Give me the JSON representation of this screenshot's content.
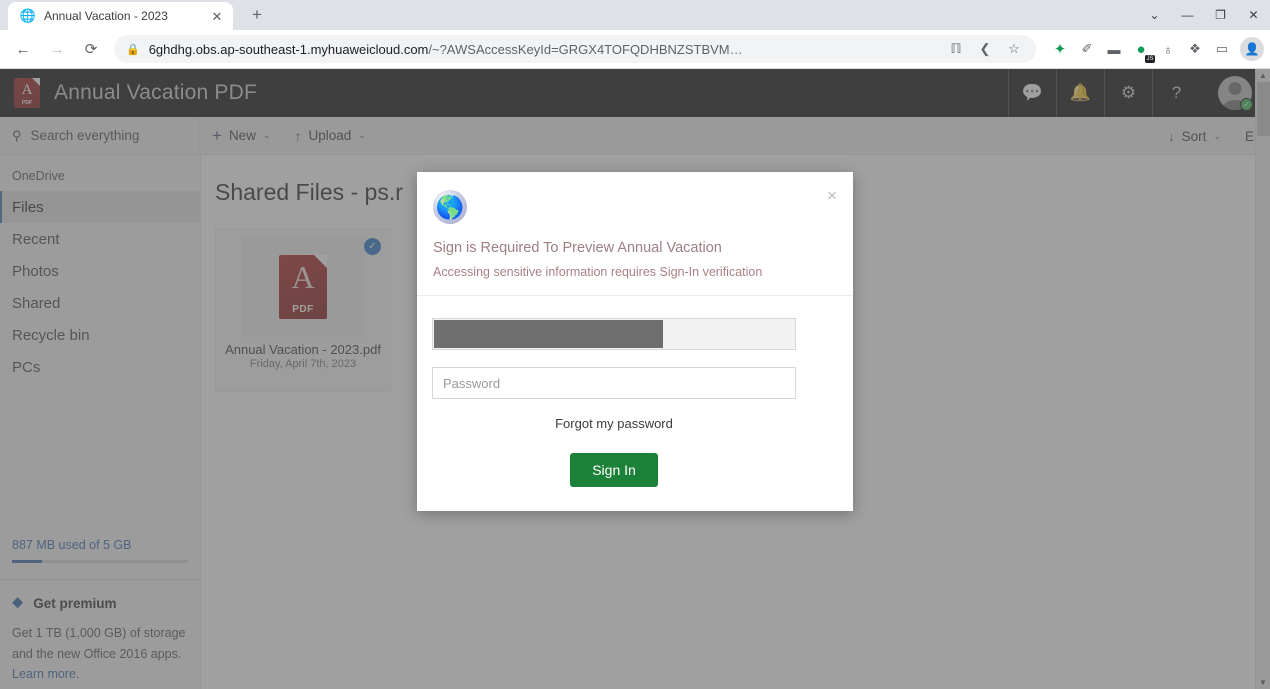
{
  "browser": {
    "tab": {
      "title": "Annual Vacation - 2023",
      "favicon": "globe-icon",
      "close_label": "✕"
    },
    "new_tab_label": "+",
    "window_controls": {
      "tab_search": "⌄",
      "minimize": "—",
      "restore": "❐",
      "close": "✕"
    },
    "nav": {
      "back": "←",
      "forward": "→",
      "reload": "⟳"
    },
    "omnibox": {
      "lock": "🔒",
      "url_host": "6ghdhg.obs.ap-southeast-1.myhuaweicloud.com",
      "url_path": "/~?AWSAccessKeyId=GRGX4TOFQDHBNZSTBVM…",
      "translate_icon": "语",
      "share_icon": "≪",
      "bookmark_icon": "☆"
    },
    "extensions": [
      {
        "name": "puzzle-green-icon",
        "glyph": "✦"
      },
      {
        "name": "pen-icon",
        "glyph": "✐"
      },
      {
        "name": "mask-icon",
        "glyph": "▬"
      },
      {
        "name": "js-extension-icon",
        "glyph": "●",
        "badge": "JS"
      },
      {
        "name": "globe-grid-icon",
        "glyph": "♁"
      },
      {
        "name": "extensions-puzzle-icon",
        "glyph": "❖"
      },
      {
        "name": "sidepanel-icon",
        "glyph": "▭"
      }
    ],
    "profile_icon": "👤"
  },
  "app_header": {
    "title": "Annual Vacation PDF",
    "pdf_badge": "PDF",
    "pdf_letter": "A",
    "icons": [
      {
        "name": "chat-icon",
        "glyph": "💬"
      },
      {
        "name": "bell-icon",
        "glyph": "🔔"
      },
      {
        "name": "gear-icon",
        "glyph": "⚙"
      },
      {
        "name": "help-icon",
        "glyph": "?"
      }
    ],
    "avatar_badge": "✓"
  },
  "toolbar": {
    "search_placeholder": "Search everything",
    "search_icon": "⚲",
    "new_label": "New",
    "new_icon": "+",
    "upload_label": "Upload",
    "upload_icon": "↑",
    "sort_label": "Sort",
    "sort_icon": "↓",
    "chevron": "⌄",
    "edge_label": "E"
  },
  "sidebar": {
    "section_label": "OneDrive",
    "items": [
      {
        "label": "Files",
        "active": true
      },
      {
        "label": "Recent",
        "active": false
      },
      {
        "label": "Photos",
        "active": false
      },
      {
        "label": "Shared",
        "active": false
      },
      {
        "label": "Recycle bin",
        "active": false
      },
      {
        "label": "PCs",
        "active": false
      }
    ],
    "storage_text": "887 MB used of 5 GB",
    "storage_percent": 17,
    "premium": {
      "icon": "⬥",
      "title": "Get premium",
      "body": "Get 1 TB (1,000 GB) of storage and the new Office 2016 apps. ",
      "link": "Learn more."
    }
  },
  "content": {
    "title": "Shared Files - ps.r",
    "file": {
      "name": "Annual Vacation - 2023.pdf",
      "date": "Friday, April 7th, 2023",
      "pdf_badge": "PDF",
      "pdf_letter": "A",
      "selected_check": "✓"
    }
  },
  "modal": {
    "icon": "globe-icon",
    "icon_glyph": "🌐",
    "close": "×",
    "title": "Sign is Required To Preview Annual Vacation",
    "subtitle": "Accessing sensitive information requires Sign-In verification",
    "email_value": "",
    "email_redacted": true,
    "password_placeholder": "Password",
    "forgot_label": "Forgot my password",
    "signin_label": "Sign In"
  },
  "scrollbar": {
    "up": "▲",
    "down": "▼"
  },
  "colors": {
    "accent_blue": "#2a5fa8",
    "signin_green": "#1c8139",
    "header_black": "#000000",
    "pdf_red": "#a91616",
    "modal_text": "#9e7f82"
  }
}
